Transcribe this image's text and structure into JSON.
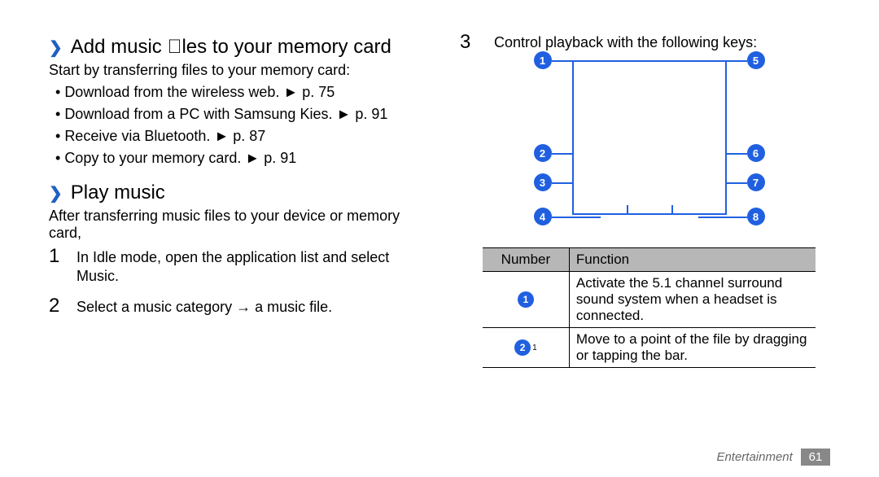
{
  "left": {
    "heading1": "Add music ￾les to your memory card",
    "intro1": "Start by transferring files to your memory card:",
    "bullets": [
      {
        "text": "Download from the wireless web.",
        "ref": "p. 75"
      },
      {
        "text": "Download from a PC with Samsung Kies.",
        "ref": "p. 91"
      },
      {
        "text": "Receive via Bluetooth.",
        "ref": "p. 87"
      },
      {
        "text": "Copy to your memory card.",
        "ref": "p. 91"
      }
    ],
    "heading2": "Play music",
    "intro2": "After transferring music files to your device or memory card,",
    "steps": [
      {
        "num": "1",
        "text": "In Idle mode, open the application list and select Music."
      },
      {
        "num": "2",
        "text": "Select a music category → a music file."
      }
    ]
  },
  "right": {
    "step3": {
      "num": "3",
      "text": "Control playback with the following keys:"
    },
    "labels": {
      "l1": "1",
      "l2": "2",
      "l3": "3",
      "l4": "4",
      "r5": "5",
      "r6": "6",
      "r7": "7",
      "r8": "8"
    },
    "table": {
      "head": {
        "number": "Number",
        "function": "Function"
      },
      "rows": [
        {
          "badge": "1",
          "sup": "",
          "func": "Activate the 5.1 channel surround sound system when a headset is connected."
        },
        {
          "badge": "2",
          "sup": "1",
          "func": "Move to a point of the file by dragging or tapping the bar."
        }
      ]
    }
  },
  "footer": {
    "section": "Entertainment",
    "page": "61"
  }
}
